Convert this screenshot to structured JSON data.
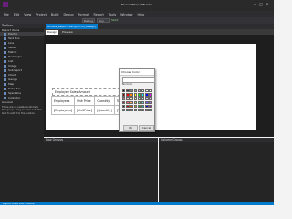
{
  "window": {
    "title": "MicrosoftReportBuilder",
    "title_full": "Access_ReportExample.rdl - Report Builder"
  },
  "menu": [
    "File",
    "Edit",
    "View",
    "Project",
    "Build",
    "Debug",
    "Format",
    "Report",
    "Tools",
    "Window",
    "Help"
  ],
  "toolbar": {
    "config": "Debug",
    "platform": "Any CPU",
    "start": "Start"
  },
  "toolbox": {
    "title": "Toolbox",
    "group": "Report Items",
    "items": [
      "Pointer",
      "Text Box",
      "Line",
      "Table",
      "Matrix",
      "Rectangle",
      "List",
      "Image",
      "Subreport",
      "Chart",
      "Gauge",
      "Map",
      "Data Bar",
      "Sparkline",
      "Indicator"
    ],
    "general": "General",
    "empty_text": "There are no usable controls in this group. Drag an item onto this text to add it to the toolbox."
  },
  "document_tabs": [
    {
      "label": "Access_ReportExample.rdl [Design]",
      "active": true
    }
  ],
  "design_tabs": [
    {
      "label": "Design",
      "active": true
    },
    {
      "label": "Preview",
      "active": false
    }
  ],
  "report": {
    "textbox_text": "Employee Sales Amount",
    "table": {
      "headers": [
        "Employees",
        "Unit Price",
        "Quantity",
        "Total"
      ],
      "row": [
        "[Employees]",
        "[UnitPrice]",
        "[Quantity]",
        "[Total]"
      ]
    }
  },
  "bottom_panels": {
    "left_title": "Row Groups",
    "right_title": "Column Groups"
  },
  "dialog": {
    "title": "Choose Color",
    "no_color": "No Color",
    "ok": "OK",
    "cancel": "Cancel",
    "swatches": [
      "#000000",
      "#404040",
      "#808080",
      "#a0a0a0",
      "#c0c0c0",
      "#e0e0e0",
      "#f0f0f0",
      "#ffffff",
      "#800000",
      "#ff0000",
      "#ff8000",
      "#ffff00",
      "#00ff00",
      "#00ffff",
      "#0000ff",
      "#ff00ff",
      "#c08080",
      "#ffc0c0",
      "#ffe0c0",
      "#ffffc0",
      "#c0ffc0",
      "#c0ffff",
      "#c0c0ff",
      "#ffc0ff",
      "#804040",
      "#ff6060",
      "#ffb060",
      "#e0e060",
      "#60e060",
      "#60e0e0",
      "#6060ff",
      "#e060e0",
      "#402020",
      "#c00000",
      "#c06000",
      "#c0c000",
      "#00c000",
      "#00c0c0",
      "#0000c0",
      "#c000c0",
      "#201010",
      "#600000",
      "#603000",
      "#606000",
      "#006000",
      "#006060",
      "#000060",
      "#600060"
    ]
  },
  "status": {
    "text": "Report Data   XML Outline"
  }
}
